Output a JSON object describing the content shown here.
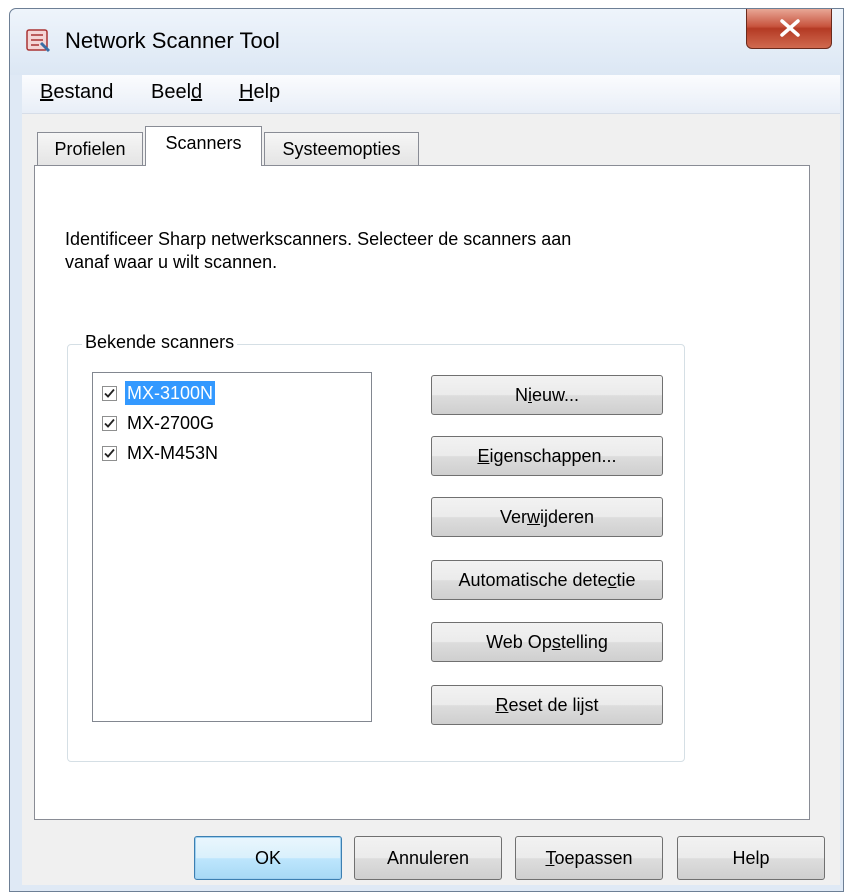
{
  "window": {
    "title": "Network Scanner Tool"
  },
  "menu": {
    "items": [
      {
        "pre": "",
        "u": "B",
        "post": "estand"
      },
      {
        "pre": "Beel",
        "u": "d",
        "post": ""
      },
      {
        "pre": "",
        "u": "H",
        "post": "elp"
      }
    ]
  },
  "tabs": [
    {
      "label": "Profielen"
    },
    {
      "label": "Scanners"
    },
    {
      "label": "Systeemopties"
    }
  ],
  "panel": {
    "description_line1": "Identificeer Sharp netwerkscanners. Selecteer de scanners aan",
    "description_line2": "vanaf waar u wilt scannen.",
    "group_title": "Bekende scanners",
    "scanners": [
      {
        "name": "MX-3100N",
        "checked": true,
        "selected": true
      },
      {
        "name": "MX-2700G",
        "checked": true,
        "selected": false
      },
      {
        "name": "MX-M453N",
        "checked": true,
        "selected": false
      }
    ],
    "buttons": [
      {
        "pre": "N",
        "u": "i",
        "post": "euw..."
      },
      {
        "pre": "",
        "u": "E",
        "post": "igenschappen..."
      },
      {
        "pre": "Ver",
        "u": "w",
        "post": "ijderen"
      },
      {
        "pre": "Automatische dete",
        "u": "c",
        "post": "tie"
      },
      {
        "pre": "Web Op",
        "u": "s",
        "post": "telling"
      },
      {
        "pre": "",
        "u": "R",
        "post": "eset de lijst"
      }
    ]
  },
  "footer": {
    "ok": "OK",
    "cancel": "Annuleren",
    "apply_pre": "",
    "apply_u": "T",
    "apply_post": "oepassen",
    "help": "Help"
  },
  "colors": {
    "selection": "#3399ff",
    "close_button": "#c7533d"
  }
}
